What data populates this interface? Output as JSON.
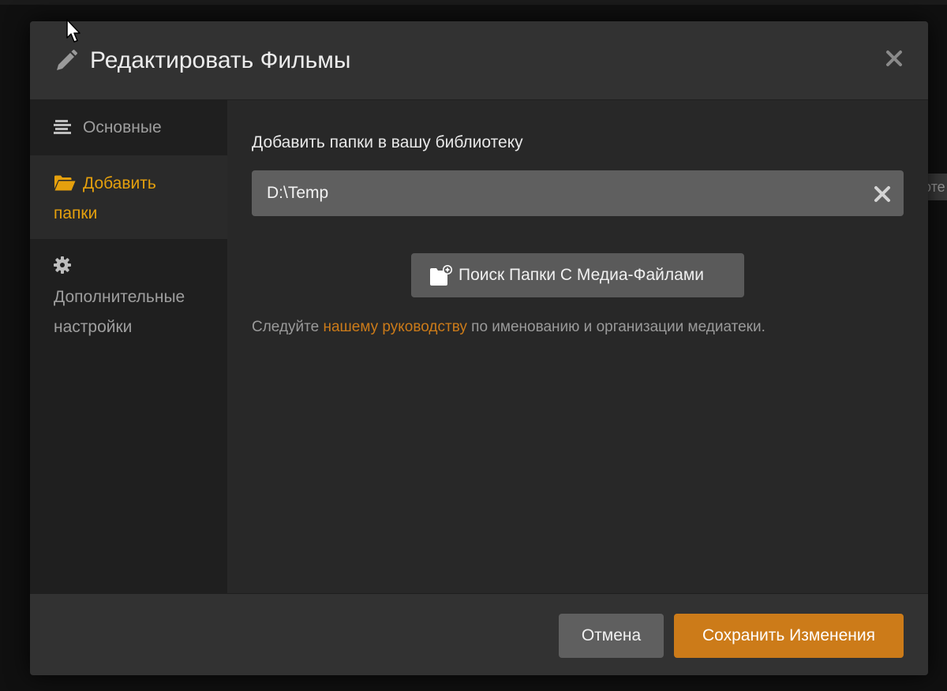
{
  "background": {
    "peek_text": "оте"
  },
  "dialog": {
    "title": "Редактировать Фильмы",
    "header_icon": "pencil-icon",
    "close_icon": "close-icon"
  },
  "sidebar": {
    "items": [
      {
        "label": "Основные",
        "icon": "list-icon",
        "active": false
      },
      {
        "label": "Добавить папки",
        "label_line1": "Добавить",
        "label_line2": "папки",
        "icon": "folder-open-icon",
        "active": true
      },
      {
        "label": "Дополнительные настройки",
        "label_line1": "Дополнительные",
        "label_line2": "настройки",
        "icon": "gear-icon",
        "active": false
      }
    ]
  },
  "content": {
    "section_label": "Добавить папки в вашу библиотеку",
    "folders": [
      {
        "path": "D:\\Temp",
        "remove_icon": "remove-icon"
      }
    ],
    "browse_button": {
      "label": "Поиск Папки С Медиа-Файлами",
      "icon": "folder-add-icon"
    },
    "hint": {
      "prefix": "Следуйте ",
      "link": "нашему руководству",
      "suffix": " по именованию и организации медиатеки."
    }
  },
  "footer": {
    "cancel_label": "Отмена",
    "save_label": "Сохранить Изменения"
  },
  "colors": {
    "accent": "#cc7b19",
    "active_nav": "#e5a00d",
    "header_bg": "#323232",
    "sidebar_bg": "#1f1f1f",
    "content_bg": "#282828"
  }
}
